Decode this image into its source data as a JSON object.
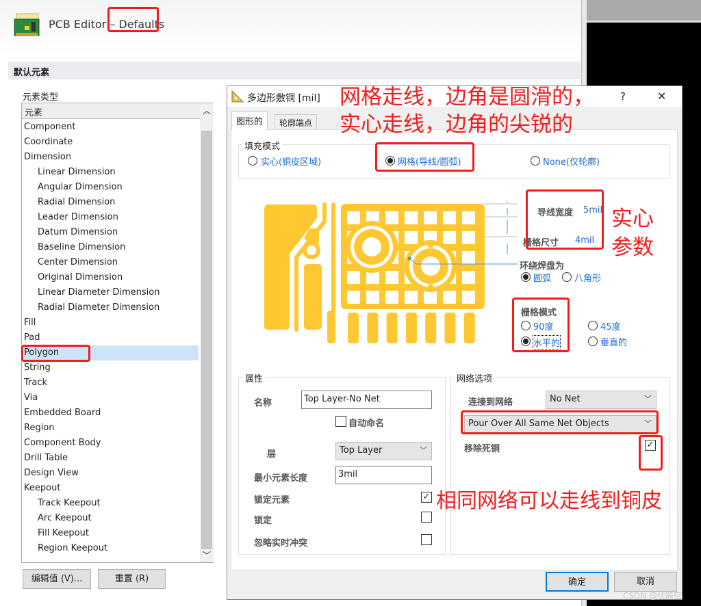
{
  "window": {
    "title_prefix": "PCB Editor – ",
    "title_highlight": "Defaults",
    "section": "默认元素",
    "list_label": "元素类型"
  },
  "list": {
    "header": "元素",
    "items": [
      {
        "label": "Component",
        "sub": false
      },
      {
        "label": "Coordinate",
        "sub": false
      },
      {
        "label": "Dimension",
        "sub": false
      },
      {
        "label": "Linear Dimension",
        "sub": true
      },
      {
        "label": "Angular Dimension",
        "sub": true
      },
      {
        "label": "Radial Dimension",
        "sub": true
      },
      {
        "label": "Leader Dimension",
        "sub": true
      },
      {
        "label": "Datum Dimension",
        "sub": true
      },
      {
        "label": "Baseline Dimension",
        "sub": true
      },
      {
        "label": "Center Dimension",
        "sub": true
      },
      {
        "label": "Original Dimension",
        "sub": true
      },
      {
        "label": "Linear Diameter Dimension",
        "sub": true
      },
      {
        "label": "Radial Diameter Dimension",
        "sub": true
      },
      {
        "label": "Fill",
        "sub": false
      },
      {
        "label": "Pad",
        "sub": false
      },
      {
        "label": "Polygon",
        "sub": false,
        "selected": true
      },
      {
        "label": "String",
        "sub": false
      },
      {
        "label": "Track",
        "sub": false
      },
      {
        "label": "Via",
        "sub": false
      },
      {
        "label": "Embedded Board",
        "sub": false
      },
      {
        "label": "Region",
        "sub": false
      },
      {
        "label": "Component Body",
        "sub": false
      },
      {
        "label": "Drill Table",
        "sub": false
      },
      {
        "label": "Design View",
        "sub": false
      },
      {
        "label": "Keepout",
        "sub": false
      },
      {
        "label": "Track Keepout",
        "sub": true
      },
      {
        "label": "Arc Keepout",
        "sub": true
      },
      {
        "label": "Fill Keepout",
        "sub": true
      },
      {
        "label": "Region Keepout",
        "sub": true
      }
    ]
  },
  "buttons": {
    "edit": "编辑值 (V)...",
    "reset": "重置 (R)"
  },
  "dialog": {
    "title": "多边形敷铜 [mil]",
    "help": "?",
    "close": "✕",
    "tabs": [
      "图形的",
      "轮廓端点"
    ],
    "fill_mode": {
      "label": "填充模式",
      "options": [
        "实心(铜皮区域)",
        "网格(导线/圆弧)",
        "None(仅轮廓)"
      ],
      "selected": 1
    },
    "track_width": {
      "label": "导线宽度",
      "value": "5mil"
    },
    "grid_size": {
      "label": "栅格尺寸",
      "value": "4mil"
    },
    "surround_pads": {
      "label": "环绕焊盘为",
      "options": [
        "圆弧",
        "八角形"
      ],
      "selected": 0
    },
    "hatch_mode": {
      "label": "栅格模式",
      "options": [
        "90度",
        "45度",
        "水平的",
        "垂直的"
      ],
      "selected": 2
    },
    "properties": {
      "label": "属性",
      "name_label": "名称",
      "name_value": "Top Layer-No Net",
      "auto_name": "自动命名",
      "auto_name_checked": false,
      "layer_label": "层",
      "layer_value": "Top Layer",
      "min_len_label": "最小元素长度",
      "min_len_value": "3mil",
      "lock_primitives": "锁定元素",
      "lock_primitives_checked": true,
      "locked": "锁定",
      "locked_checked": false,
      "ignore_online": "忽略实时冲突",
      "ignore_online_checked": false
    },
    "net_options": {
      "label": "网络选项",
      "connect_label": "连接到网络",
      "connect_value": "No Net",
      "pour_value": "Pour Over All Same Net Objects",
      "remove_dead": "移除死铜",
      "remove_dead_checked": true
    },
    "ok": "确定",
    "cancel": "取消"
  },
  "annotations": {
    "top1": "网格走线，边角是圆滑的，",
    "top2": "实心走线，边角的尖锐的",
    "solid1": "实心",
    "solid2": "参数",
    "bottom": "相同网络可以走线到铜皮",
    "color": "#f21c1c"
  },
  "watermark": "CSDN @伏辰空",
  "colors": {
    "copper": "#ffc832",
    "link": "#1a6bd0"
  }
}
